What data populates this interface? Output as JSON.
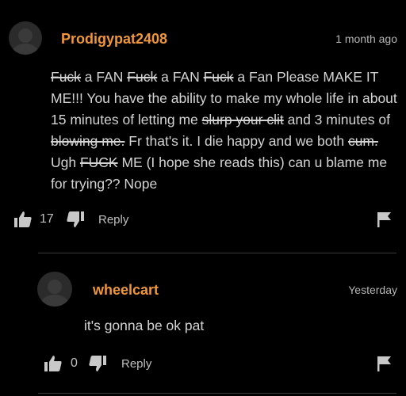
{
  "comments": [
    {
      "username": "Prodigypat2408",
      "time": "1 month ago",
      "body": [
        {
          "text": "Fuck",
          "strike": true
        },
        {
          "text": " a FAN ",
          "strike": false
        },
        {
          "text": "Fuck",
          "strike": true
        },
        {
          "text": " a FAN ",
          "strike": false
        },
        {
          "text": "Fuck",
          "strike": true
        },
        {
          "text": " a Fan Please MAKE IT ME!!! You have the ability to make my whole life in about 15 minutes of letting me ",
          "strike": false
        },
        {
          "text": "slurp your clit",
          "strike": true
        },
        {
          "text": " and 3 minutes of ",
          "strike": false
        },
        {
          "text": "blowing me.",
          "strike": true
        },
        {
          "text": " Fr that's it. I die happy and we both ",
          "strike": false
        },
        {
          "text": "cum.",
          "strike": true
        },
        {
          "text": " Ugh ",
          "strike": false
        },
        {
          "text": "FUCK",
          "strike": true
        },
        {
          "text": " ME (I hope she reads this) can u blame me for trying?? Nope",
          "strike": false
        }
      ],
      "upvotes": "17",
      "reply_label": "Reply"
    },
    {
      "username": "wheelcart",
      "time": "Yesterday",
      "body": [
        {
          "text": "it's gonna be ok pat",
          "strike": false
        }
      ],
      "upvotes": "0",
      "reply_label": "Reply"
    }
  ],
  "colors": {
    "background": "#000000",
    "username": "#f0973a",
    "text": "#d4d4d4",
    "muted": "#b6b6b6"
  },
  "icons": [
    "avatar",
    "thumbs-up-icon",
    "thumbs-down-icon",
    "flag-icon"
  ]
}
